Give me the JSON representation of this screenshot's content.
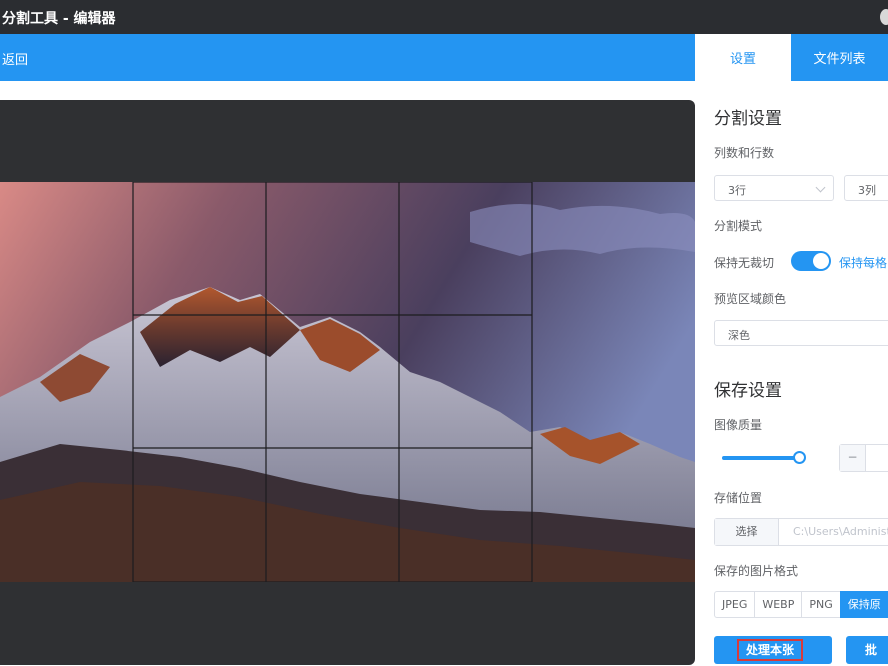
{
  "window": {
    "title": "分割工具 - 编辑器"
  },
  "header": {
    "back_label": "返回"
  },
  "tabs": [
    {
      "label": "设置",
      "active": true
    },
    {
      "label": "文件列表",
      "active": false
    }
  ],
  "settings": {
    "split_title": "分割设置",
    "grid_label": "列数和行数",
    "rows_value": "3行",
    "cols_value": "3列",
    "mode_label": "分割模式",
    "mode_off_label": "保持无裁切",
    "mode_on_label": "保持每格",
    "mode_toggle_on": true,
    "preview_color_label": "预览区域颜色",
    "preview_color_value": "深色",
    "save_title": "保存设置",
    "quality_label": "图像质量",
    "quality_level_fraction": 1.0,
    "stepper_minus": "−",
    "location_label": "存储位置",
    "location_button": "选择",
    "location_path": "C:\\Users\\Administr",
    "format_label": "保存的图片格式",
    "formats": [
      "JPEG",
      "WEBP",
      "PNG",
      "保持原"
    ],
    "format_selected": "保持原",
    "process_button": "处理本张",
    "process_all_button": "批"
  },
  "colors": {
    "accent": "#2495f2",
    "titlebar": "#2b2d31",
    "canvas_bg": "#2f3033",
    "highlight_border": "#d83a3a"
  },
  "icons": {
    "row_select": "chevron-down-icon",
    "window_control": "circle-icon"
  }
}
